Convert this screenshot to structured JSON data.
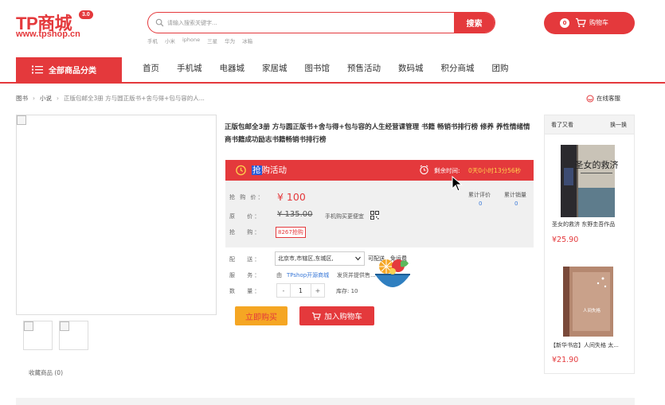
{
  "header": {
    "logo_text": "TP商城",
    "logo_version": "3.0",
    "logo_url": "www.tpshop.cn",
    "search_placeholder": "请输入搜索关键字...",
    "search_button": "搜索",
    "hot_words": [
      "手机",
      "小米",
      "iphone",
      "三星",
      "华为",
      "冰箱"
    ],
    "cart_count": "0",
    "cart_label": "购物车"
  },
  "nav": {
    "all_categories": "全部商品分类",
    "items": [
      "首页",
      "手机城",
      "电器城",
      "家居城",
      "图书馆",
      "预售活动",
      "数码城",
      "积分商城",
      "团购"
    ]
  },
  "breadcrumb": {
    "items": [
      "图书",
      "小说",
      "正版包邮全3册 方与圆正版书+舍与得+包与容的人..."
    ],
    "online_service": "在线客服"
  },
  "gallery": {
    "favorite_label": "收藏商品 (0)"
  },
  "product": {
    "title": "正版包邮全3册 方与圆正版书+舍与得+包与容的人生经营课管理 书籍 畅销书排行榜 修养 养性情绪情商书籍成功励志书籍畅销书排行榜",
    "flash_label_highlight": "抢",
    "flash_label_rest": "购活动",
    "countdown_label": "剩余时间:",
    "countdown_value": "0天0小时13分56秒",
    "price_label": "抢 购 价：",
    "price": "¥ 100",
    "original_label": "原　 价：",
    "original_price": "¥ 135.00",
    "mobile_deal": "手机购买更便宜",
    "flash_sold_label": "抢　 购：",
    "flash_sold_badge": "8267抢购",
    "reviews_label": "累计评价",
    "reviews_count": "0",
    "sales_label": "累计销量",
    "sales_count": "0",
    "delivery_label": "配　 送：",
    "delivery_region": "北京市,市辖区,东城区,",
    "delivery_status": "可配送",
    "shipping_fee": "免运费",
    "service_label": "服　 务：",
    "service_by": "由",
    "service_shop": "TPshop开源商城",
    "service_rest": "发货并提供售...",
    "qty_label": "数　 量：",
    "qty_minus": "-",
    "qty_value": "1",
    "qty_plus": "+",
    "stock_label": "库存: 10",
    "buy_now": "立即购买",
    "add_to_cart": "加入购物车"
  },
  "sidebar": {
    "title": "看了又看",
    "refresh": "换一换",
    "items": [
      {
        "name": "圣女的救济 东野圭吾作品",
        "price": "¥25.90",
        "cover_text": "圣女的救济"
      },
      {
        "name": "【新华书店】人间失格 太...",
        "price": "¥21.90",
        "cover_text": "人间失格"
      }
    ]
  },
  "colors": {
    "brand_red": "#e4393c",
    "buy_orange": "#f5a623",
    "countdown_yellow": "#ffd34d",
    "link_blue": "#3a79d8"
  }
}
